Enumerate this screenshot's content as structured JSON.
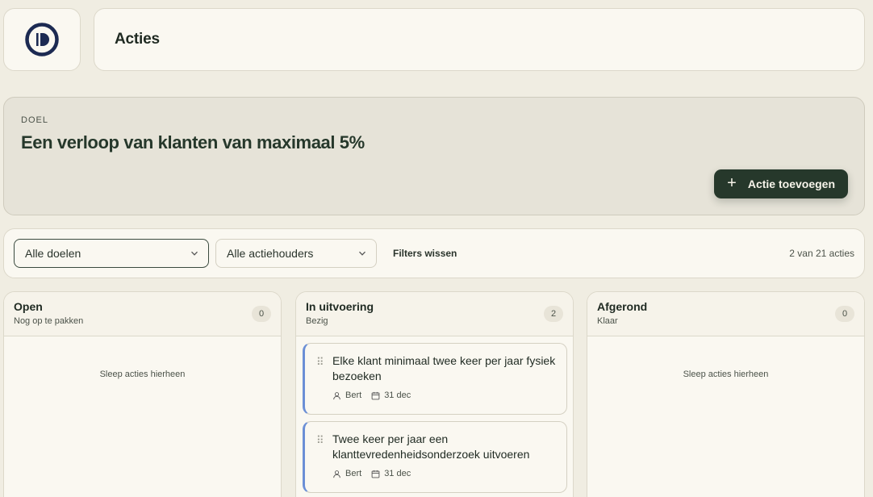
{
  "header": {
    "title": "Acties",
    "logo": "logo-d"
  },
  "goal": {
    "eyebrow": "DOEL",
    "title": "Een verloop van klanten van maximaal 5%",
    "add_button": "Actie toevoegen",
    "add_icon": "plus-icon"
  },
  "filters": {
    "goal_select": "Alle doelen",
    "owner_select": "Alle actiehouders",
    "clear": "Filters wissen",
    "count": "2 van 21 acties"
  },
  "columns": [
    {
      "title": "Open",
      "subtitle": "Nog op te pakken",
      "count": "0",
      "empty": "Sleep acties hierheen"
    },
    {
      "title": "In uitvoering",
      "subtitle": "Bezig",
      "count": "2"
    },
    {
      "title": "Afgerond",
      "subtitle": "Klaar",
      "count": "0",
      "empty": "Sleep acties hierheen"
    }
  ],
  "cards": [
    {
      "title": "Elke klant minimaal twee keer per jaar fysiek bezoeken",
      "owner": "Bert",
      "due": "31 dec"
    },
    {
      "title": "Twee keer per jaar een klanttevredenheidsonderzoek uitvoeren",
      "owner": "Bert",
      "due": "31 dec"
    }
  ],
  "colors": {
    "primary": "#26382b",
    "background": "#f0ede2",
    "card_accent": "#6b8fd6",
    "logo": "#1c2a52"
  }
}
